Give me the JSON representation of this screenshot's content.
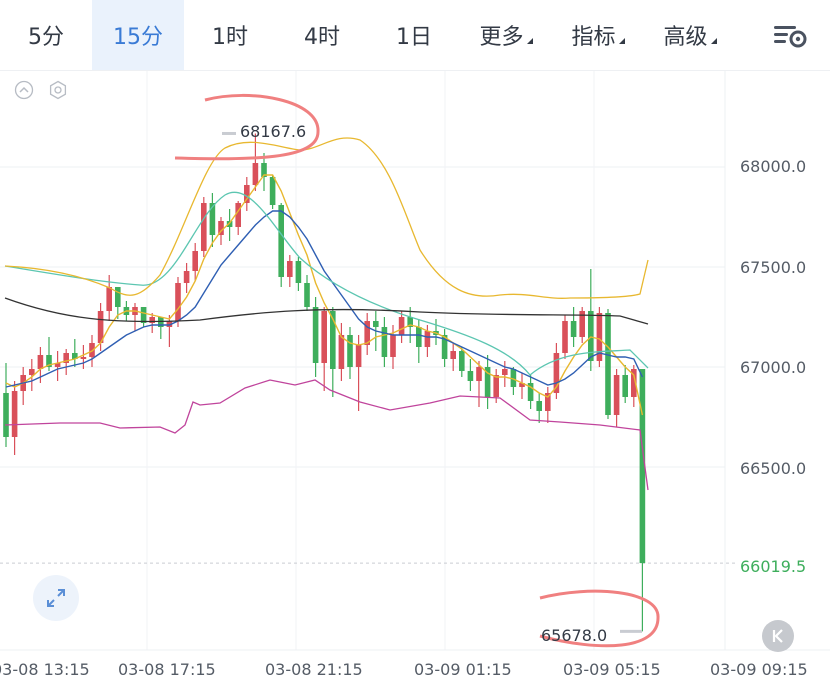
{
  "tabs": [
    {
      "label": "5分",
      "active": false
    },
    {
      "label": "15分",
      "active": true
    },
    {
      "label": "1时",
      "active": false
    },
    {
      "label": "4时",
      "active": false
    },
    {
      "label": "1日",
      "active": false
    },
    {
      "label": "更多",
      "active": false,
      "dropdown": true
    },
    {
      "label": "指标",
      "active": false,
      "dropdown": true
    },
    {
      "label": "高级",
      "active": false,
      "dropdown": true
    }
  ],
  "colors": {
    "active_tab": "#3a7bd5",
    "up_candle": "#d9505a",
    "down_candle": "#3eae5c",
    "annotation": "#f08080"
  },
  "icons": [
    "chart-settings-icon",
    "collapse-icon",
    "indicator-settings-icon",
    "expand-icon",
    "reset-k-icon"
  ],
  "chart_data": {
    "type": "candlestick",
    "y_axis_labels": [
      "68000.0",
      "67500.0",
      "67000.0",
      "66500.0"
    ],
    "current_price": "66019.5",
    "x_axis_labels": [
      "03-08 13:15",
      "03-08 17:15",
      "03-08 21:15",
      "03-09 01:15",
      "03-09 05:15",
      "03-09 09:15"
    ],
    "high_marker": "68167.6",
    "low_marker": "65678.0",
    "ylim": [
      65500,
      68350
    ],
    "candles": [
      [
        66870,
        67020,
        66600,
        66650
      ],
      [
        66650,
        66930,
        66560,
        66880
      ],
      [
        66880,
        67000,
        66810,
        66960
      ],
      [
        66960,
        67040,
        66880,
        66990
      ],
      [
        66990,
        67100,
        66920,
        67060
      ],
      [
        67060,
        67150,
        66980,
        67000
      ],
      [
        67000,
        67080,
        66930,
        67020
      ],
      [
        67020,
        67090,
        66960,
        67070
      ],
      [
        67070,
        67140,
        67000,
        67040
      ],
      [
        67040,
        67110,
        66990,
        67050
      ],
      [
        67050,
        67160,
        67000,
        67120
      ],
      [
        67120,
        67320,
        67080,
        67280
      ],
      [
        67280,
        67460,
        67230,
        67400
      ],
      [
        67400,
        67380,
        67240,
        67300
      ],
      [
        67300,
        67330,
        67230,
        67260
      ],
      [
        67260,
        67320,
        67180,
        67300
      ],
      [
        67300,
        67290,
        67200,
        67220
      ],
      [
        67220,
        67270,
        67170,
        67250
      ],
      [
        67250,
        67250,
        67140,
        67200
      ],
      [
        67200,
        67260,
        67100,
        67230
      ],
      [
        67230,
        67450,
        67200,
        67420
      ],
      [
        67420,
        67520,
        67370,
        67480
      ],
      [
        67480,
        67620,
        67430,
        67580
      ],
      [
        67580,
        67850,
        67550,
        67820
      ],
      [
        67820,
        67870,
        67600,
        67660
      ],
      [
        67660,
        67750,
        67610,
        67730
      ],
      [
        67730,
        67790,
        67630,
        67700
      ],
      [
        67700,
        67830,
        67660,
        67820
      ],
      [
        67820,
        67950,
        67780,
        67910
      ],
      [
        67910,
        68167.6,
        67880,
        68020
      ],
      [
        68020,
        68070,
        67880,
        67950
      ],
      [
        67950,
        67960,
        67790,
        67810
      ],
      [
        67810,
        67820,
        67400,
        67450
      ],
      [
        67450,
        67560,
        67400,
        67530
      ],
      [
        67530,
        67550,
        67380,
        67420
      ],
      [
        67420,
        67460,
        67280,
        67300
      ],
      [
        67300,
        67350,
        66950,
        67020
      ],
      [
        67020,
        67300,
        66880,
        67280
      ],
      [
        67280,
        67300,
        66850,
        66990
      ],
      [
        66990,
        67220,
        66930,
        67160
      ],
      [
        67160,
        67200,
        66940,
        67000
      ],
      [
        67000,
        67160,
        66780,
        67110
      ],
      [
        67110,
        67270,
        67060,
        67230
      ],
      [
        67230,
        67280,
        67080,
        67200
      ],
      [
        67200,
        67250,
        67000,
        67050
      ],
      [
        67050,
        67210,
        66990,
        67160
      ],
      [
        67160,
        67280,
        67120,
        67250
      ],
      [
        67250,
        67300,
        67120,
        67200
      ],
      [
        67200,
        67240,
        67020,
        67100
      ],
      [
        67100,
        67210,
        67050,
        67180
      ],
      [
        67180,
        67240,
        67110,
        67160
      ],
      [
        67160,
        67190,
        67000,
        67040
      ],
      [
        67040,
        67120,
        66980,
        67080
      ],
      [
        67080,
        67100,
        66950,
        66980
      ],
      [
        66980,
        67040,
        66880,
        66930
      ],
      [
        66930,
        67030,
        66800,
        67000
      ],
      [
        67000,
        67060,
        66790,
        66850
      ],
      [
        66850,
        66990,
        66820,
        66960
      ],
      [
        66960,
        67030,
        66900,
        66990
      ],
      [
        66990,
        67000,
        66860,
        66900
      ],
      [
        66900,
        66970,
        66840,
        66920
      ],
      [
        66920,
        66960,
        66790,
        66830
      ],
      [
        66830,
        66870,
        66720,
        66780
      ],
      [
        66780,
        66900,
        66720,
        66870
      ],
      [
        66870,
        67120,
        66840,
        67070
      ],
      [
        67070,
        67260,
        67040,
        67230
      ],
      [
        67230,
        67300,
        67100,
        67150
      ],
      [
        67150,
        67300,
        67120,
        67280
      ],
      [
        67280,
        67490,
        66980,
        67030
      ],
      [
        67030,
        67300,
        67000,
        67270
      ],
      [
        67270,
        67290,
        66740,
        66760
      ],
      [
        66760,
        66990,
        66700,
        66960
      ],
      [
        66960,
        67010,
        66820,
        66850
      ],
      [
        66850,
        67010,
        66800,
        66990
      ],
      [
        66990,
        66990,
        65678,
        66019.5
      ]
    ],
    "ma_yellow": [
      66920,
      66900,
      66920,
      66950,
      66990,
      67010,
      67020,
      67030,
      67040,
      67060,
      67080,
      67120,
      67200,
      67260,
      67280,
      67280,
      67270,
      67260,
      67250,
      67240,
      67290,
      67350,
      67430,
      67540,
      67620,
      67680,
      67720,
      67780,
      67840,
      67900,
      67960,
      67960,
      67880,
      67770,
      67660,
      67560,
      67420,
      67320,
      67240,
      67150,
      67120,
      67110,
      67120,
      67150,
      67160,
      67170,
      67190,
      67210,
      67200,
      67180,
      67170,
      67150,
      67120,
      67090,
      67050,
      67010,
      66970,
      66950,
      66950,
      66940,
      66920,
      66900,
      66870,
      66850,
      66900,
      66980,
      67050,
      67110,
      67150,
      67140,
      67100,
      67050,
      67000,
      66960,
      66760
    ],
    "ma_blue": [
      66900,
      66910,
      66920,
      66930,
      66950,
      66970,
      66990,
      67000,
      67010,
      67020,
      67040,
      67070,
      67100,
      67130,
      67160,
      67180,
      67200,
      67210,
      67210,
      67210,
      67230,
      67260,
      67300,
      67370,
      67440,
      67510,
      67560,
      67610,
      67660,
      67710,
      67750,
      67780,
      67780,
      67750,
      67700,
      67640,
      67560,
      67480,
      67420,
      67360,
      67300,
      67240,
      67200,
      67180,
      67170,
      67160,
      67160,
      67160,
      67160,
      67150,
      67150,
      67140,
      67120,
      67100,
      67080,
      67060,
      67040,
      67020,
      67000,
      66990,
      66970,
      66950,
      66930,
      66910,
      66920,
      66940,
      66970,
      67010,
      67050,
      67070,
      67060,
      67050,
      67050,
      67040,
      66950
    ]
  }
}
